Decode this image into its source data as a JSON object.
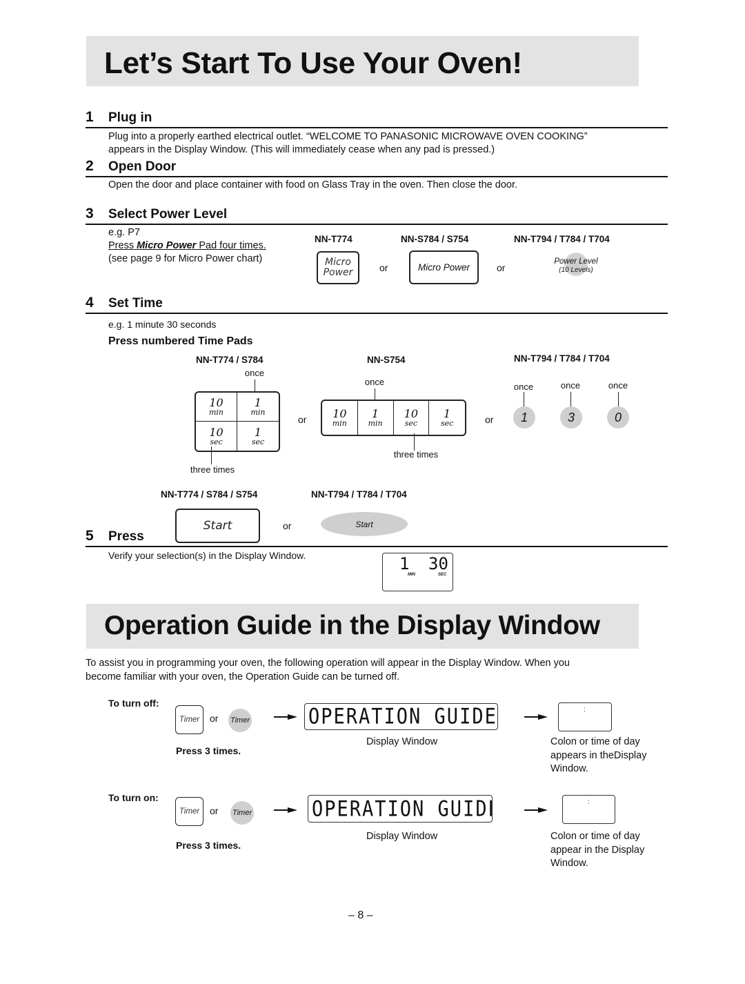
{
  "page_title": "Let’s Start To Use Your Oven!",
  "steps": [
    {
      "num": "1",
      "title": "Plug in",
      "text_line1": "Plug into a properly earthed electrical outlet. “WELCOME TO PANASONIC MICROWAVE OVEN COOKING”",
      "text_line2": "appears in the Display Window. (This will immediately cease when any pad is pressed.)"
    },
    {
      "num": "2",
      "title": "Open Door",
      "text_line1": "Open the door and place container with food on Glass Tray in the oven. Then close the door."
    },
    {
      "num": "3",
      "title": "Select Power Level",
      "example": "e.g. P7",
      "instruction_prefix": "Press ",
      "instruction_pad": "Micro Power",
      "instruction_suffix": " Pad four times.",
      "reference": "(see page 9 for Micro Power chart)",
      "models": [
        "NN-T774",
        "NN-S784 / S754",
        "NN-T794 / T784 / T704"
      ],
      "pad_t774_line1": "Micro",
      "pad_t774_line2": "Power",
      "pad_s784": "Micro Power",
      "pad_t794_line1": "Power Level",
      "pad_t794_line2": "(10 Levels)",
      "or": "or"
    },
    {
      "num": "4",
      "title": "Set Time",
      "example": "e.g. 1 minute 30 seconds",
      "subheading": "Press numbered Time Pads",
      "models": [
        "NN-T774 / S784",
        "NN-S754",
        "NN-T794 / T784 / T704"
      ],
      "pad_cells": [
        {
          "value": "10",
          "unit": "min"
        },
        {
          "value": "1",
          "unit": "min"
        },
        {
          "value": "10",
          "unit": "sec"
        },
        {
          "value": "1",
          "unit": "sec"
        }
      ],
      "once": "once",
      "three_times": "three times",
      "circle_pads": [
        "1",
        "3",
        "0"
      ],
      "or": "or"
    },
    {
      "num": "5",
      "title": "Press",
      "models": [
        "NN-T774 / S784 / S754",
        "NN-T794 / T784 / T704"
      ],
      "start_label": "Start",
      "or": "or",
      "verify_text": "Verify your selection(s) in the Display Window.",
      "display_min": "1",
      "display_sec": "30",
      "display_min_label": "MIN",
      "display_sec_label": "SEC"
    }
  ],
  "guide": {
    "title": "Operation Guide in the Display Window",
    "intro_line1": "To assist you in programming your oven, the following operation will appear in the Display Window. When you",
    "intro_line2": "become familiar with your oven, the Operation Guide can be turned off.",
    "rows": [
      {
        "label": "To turn off:",
        "pad": "Timer",
        "or": "or",
        "press": "Press 3 times.",
        "display": "OPERATION GUIDE OFF",
        "display_caption": "Display Window",
        "colon": ":",
        "result_line1": "Colon or time of day",
        "result_line2": "appears in theDisplay",
        "result_line3": "Window."
      },
      {
        "label": "To turn on:",
        "pad": "Timer",
        "or": "or",
        "press": "Press 3 times.",
        "display": "OPERATION GUIDE ON",
        "display_caption": "Display Window",
        "colon": ":",
        "result_line1": "Colon or time of day",
        "result_line2": "appear in the Display",
        "result_line3": "Window."
      }
    ]
  },
  "page_number": "– 8 –"
}
